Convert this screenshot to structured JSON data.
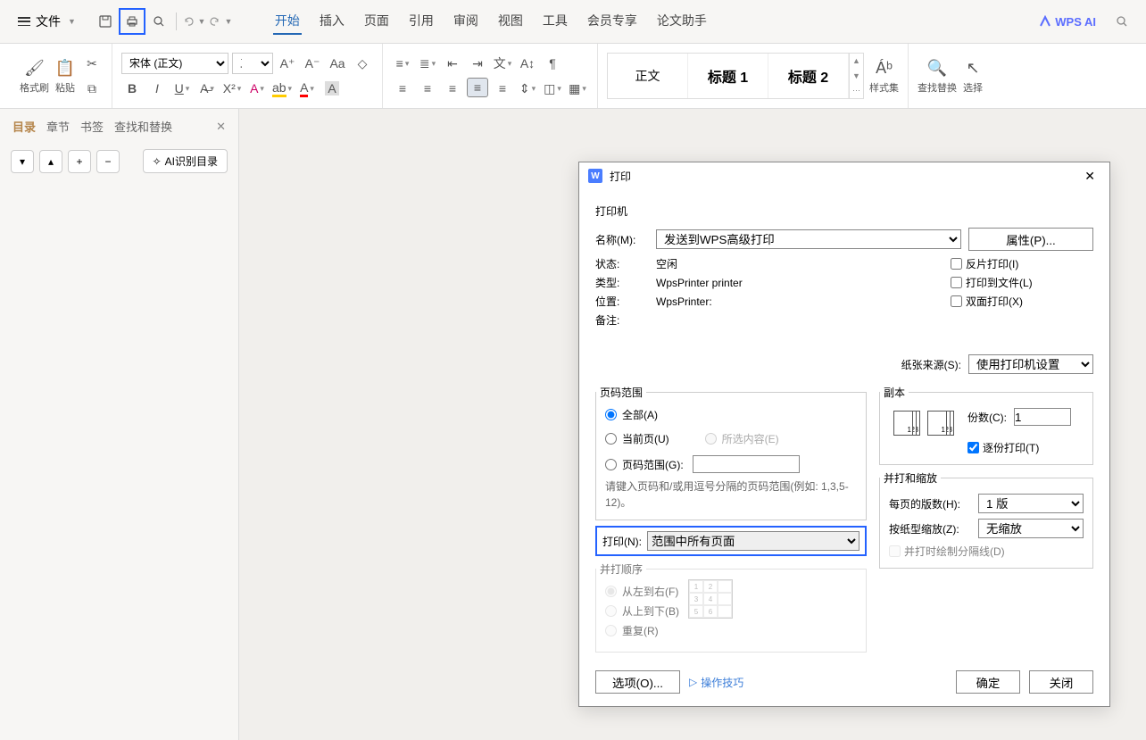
{
  "menu": {
    "file": "文件",
    "tabs": [
      "开始",
      "插入",
      "页面",
      "引用",
      "审阅",
      "视图",
      "工具",
      "会员专享",
      "论文助手"
    ],
    "active_tab": 0,
    "wps_ai": "WPS AI"
  },
  "ribbon": {
    "format_painter": "格式刷",
    "paste": "粘贴",
    "font_name": "宋体 (正文)",
    "font_size": "五号",
    "styles": {
      "normal": "正文",
      "h1": "标题 1",
      "h2": "标题 2"
    },
    "style_set": "样式集",
    "find_replace": "查找替换",
    "select": "选择"
  },
  "sidepanel": {
    "tabs": [
      "目录",
      "章节",
      "书签",
      "查找和替换"
    ],
    "active": 0,
    "ai_toc": "AI识别目录"
  },
  "dialog": {
    "title": "打印",
    "printer_section": "打印机",
    "name_label": "名称(M):",
    "name_value": "发送到WPS高级打印",
    "properties_btn": "属性(P)...",
    "status_label": "状态:",
    "status_value": "空闲",
    "type_label": "类型:",
    "type_value": "WpsPrinter printer",
    "location_label": "位置:",
    "location_value": "WpsPrinter:",
    "comment_label": "备注:",
    "mirror": "反片打印(I)",
    "to_file": "打印到文件(L)",
    "duplex": "双面打印(X)",
    "paper_source_label": "纸张来源(S):",
    "paper_source_value": "使用打印机设置",
    "page_range_section": "页码范围",
    "all": "全部(A)",
    "current": "当前页(U)",
    "selection": "所选内容(E)",
    "page_range": "页码范围(G):",
    "hint": "请键入页码和/或用逗号分隔的页码范围(例如: 1,3,5-12)。",
    "print_n_label": "打印(N):",
    "print_n_value": "范围中所有页面",
    "copies_section": "副本",
    "copies_label": "份数(C):",
    "copies_value": "1",
    "collate": "逐份打印(T)",
    "order_section": "并打顺序",
    "ltr": "从左到右(F)",
    "ttb": "从上到下(B)",
    "repeat": "重复(R)",
    "scale_section": "并打和缩放",
    "pps_label": "每页的版数(H):",
    "pps_value": "1 版",
    "scale_label": "按纸型缩放(Z):",
    "scale_value": "无缩放",
    "draw_lines": "并打时绘制分隔线(D)",
    "options_btn": "选项(O)...",
    "tips": "操作技巧",
    "ok": "确定",
    "cancel": "关闭"
  }
}
